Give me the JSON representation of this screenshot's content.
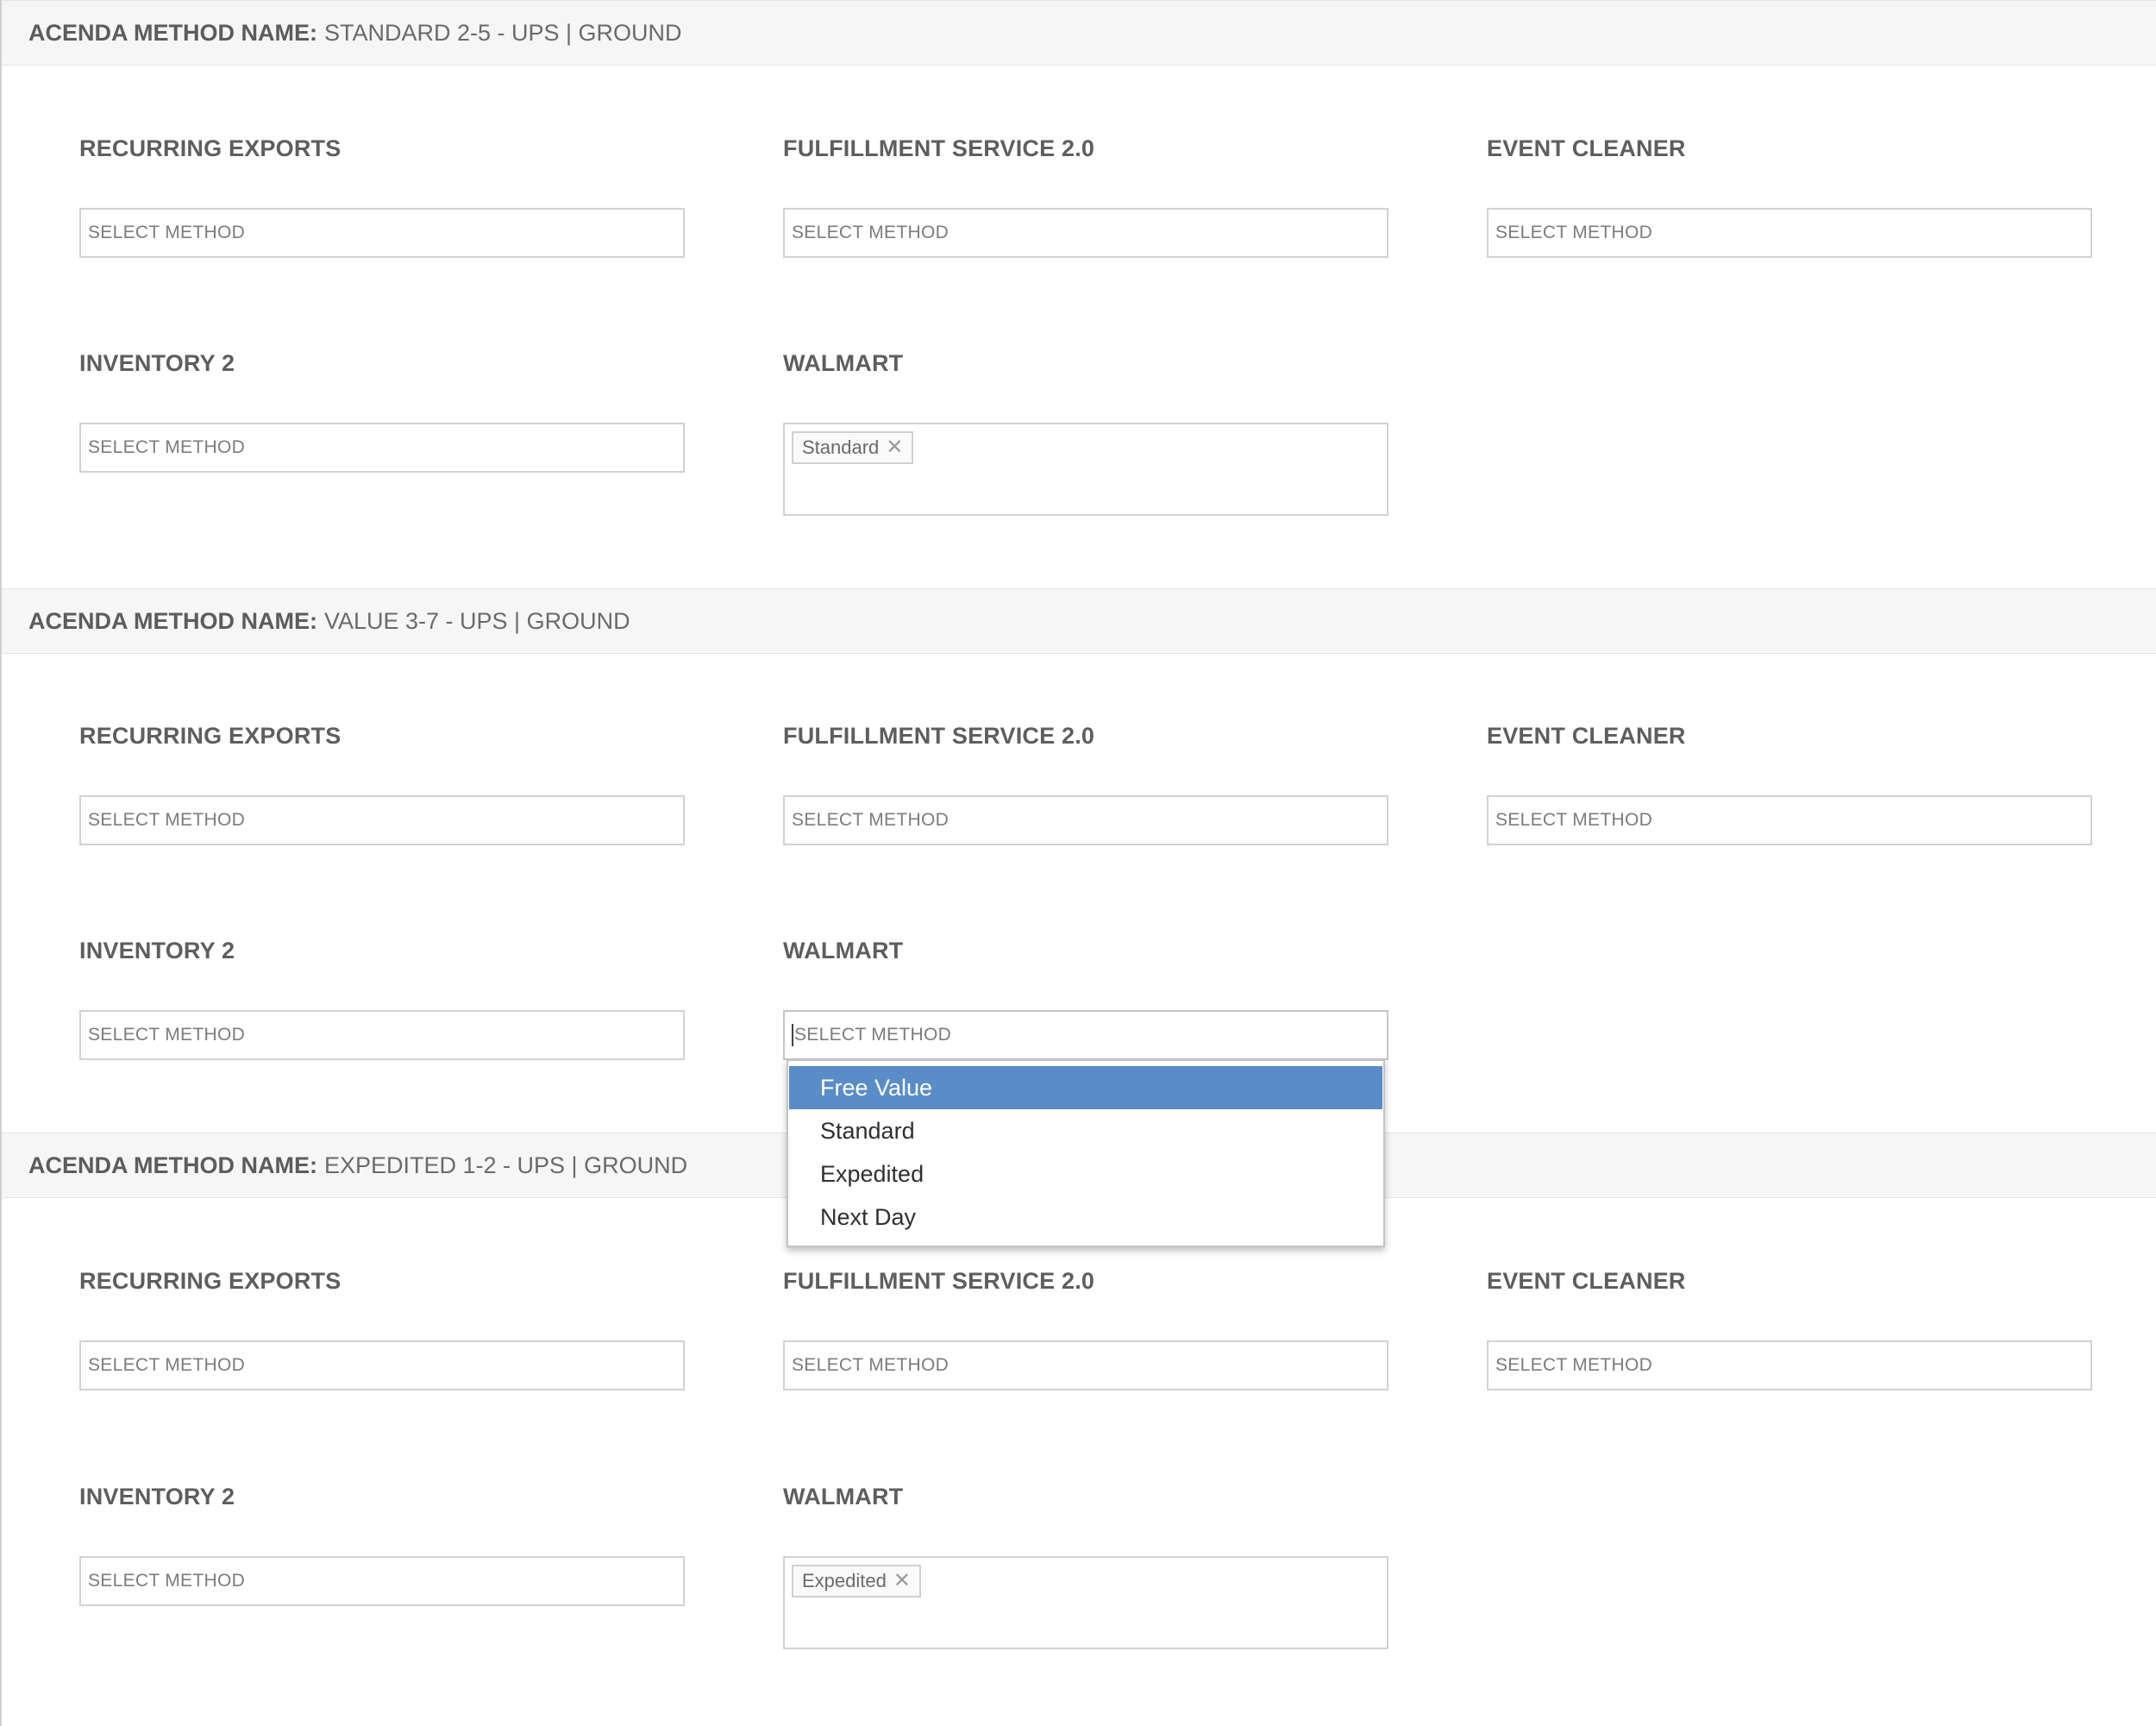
{
  "labels": {
    "prefix": "ACENDA METHOD NAME:",
    "recurring_exports": "RECURRING EXPORTS",
    "fulfillment_service": "FULFILLMENT SERVICE 2.0",
    "event_cleaner": "EVENT CLEANER",
    "inventory": "INVENTORY 2",
    "walmart": "WALMART",
    "placeholder": "SELECT METHOD"
  },
  "sections": [
    {
      "method_name": "STANDARD 2-5 - UPS | GROUND",
      "walmart_tag": "Standard"
    },
    {
      "method_name": "VALUE 3-7 - UPS | GROUND",
      "walmart_tag": ""
    },
    {
      "method_name": "EXPEDITED 1-2 - UPS | GROUND",
      "walmart_tag": "Expedited"
    }
  ],
  "dropdown": {
    "options": [
      "Free Value",
      "Standard",
      "Expedited",
      "Next Day"
    ],
    "highlighted": "Free Value"
  },
  "colors": {
    "highlight": "#5a8cc8",
    "header_bg": "#f6f6f6"
  },
  "icons": {
    "tag_remove": "close-icon"
  }
}
